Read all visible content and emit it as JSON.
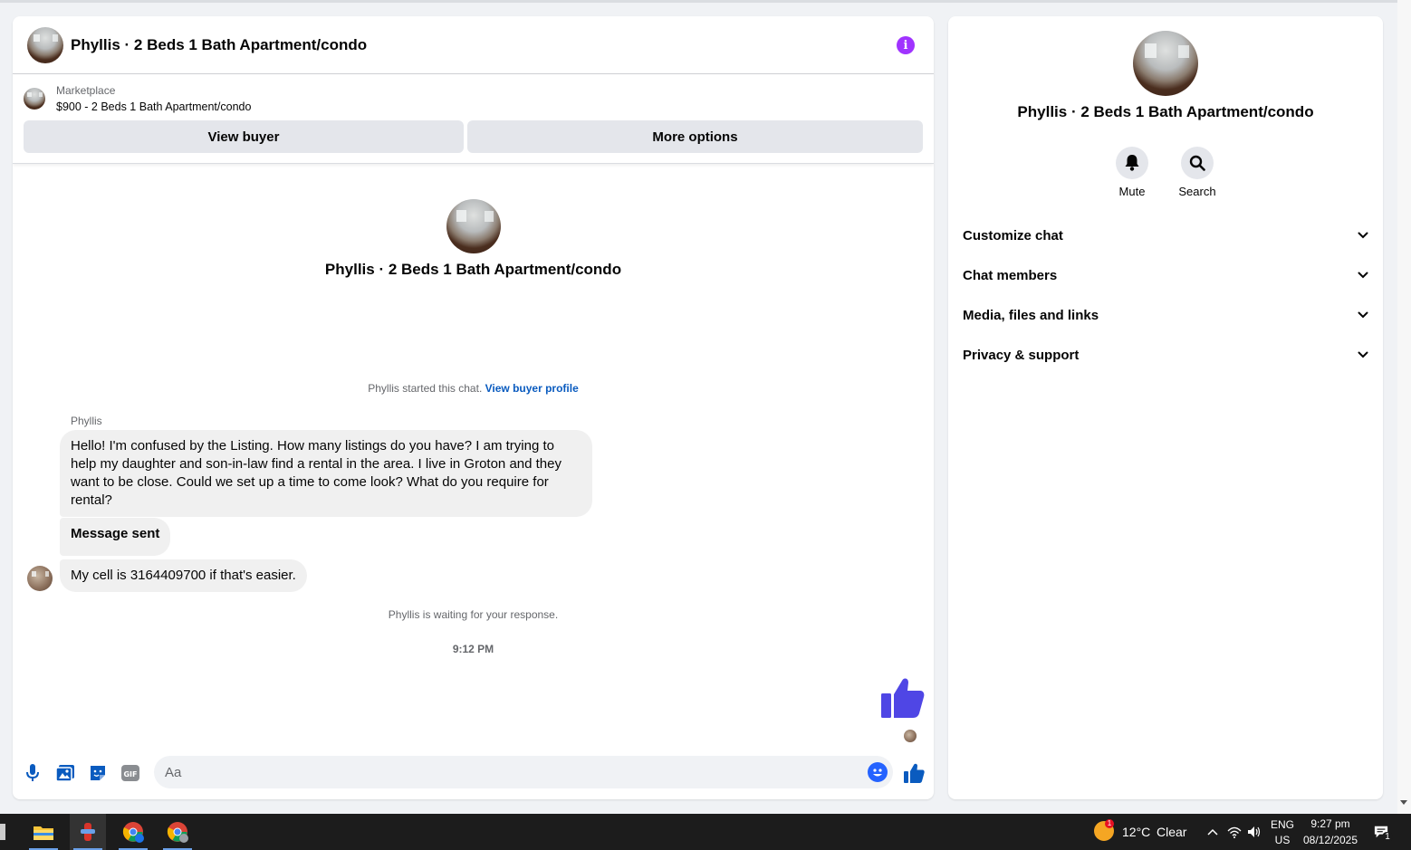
{
  "header": {
    "title": "Phyllis · 2 Beds 1 Bath Apartment/condo"
  },
  "marketplace": {
    "label": "Marketplace",
    "listing": "$900 - 2 Beds 1 Bath Apartment/condo",
    "view_buyer_label": "View buyer",
    "more_options_label": "More options"
  },
  "conversation": {
    "intro_title": "Phyllis · 2 Beds 1 Bath Apartment/condo",
    "started_text": "Phyllis started this chat.",
    "view_buyer_profile": "View buyer profile",
    "sender_name": "Phyllis",
    "messages": [
      "Hello!  I'm confused by the Listing.  How many listings do you have?  I am trying to help my daughter and son-in-law find a rental in the area.  I live in Groton and they want to be close.  Could we set up a time to come look?  What do you require for rental?",
      "Message sent",
      "My cell is 3164409700 if that's easier."
    ],
    "waiting_text": "Phyllis is waiting for your response.",
    "timestamp": "9:12 PM"
  },
  "composer": {
    "placeholder": "Aa",
    "gif_label": "GIF"
  },
  "side_panel": {
    "title": "Phyllis · 2 Beds 1 Bath Apartment/condo",
    "actions": [
      {
        "label": "Mute",
        "icon": "bell-icon"
      },
      {
        "label": "Search",
        "icon": "search-icon"
      }
    ],
    "sections": [
      {
        "label": "Customize chat"
      },
      {
        "label": "Chat members"
      },
      {
        "label": "Media, files and links"
      },
      {
        "label": "Privacy & support"
      }
    ]
  },
  "taskbar": {
    "weather_temp": "12°C",
    "weather_desc": "Clear",
    "weather_badge": "1",
    "lang_top": "ENG",
    "lang_bottom": "US",
    "time": "9:27 pm",
    "date": "08/12/2025",
    "notification_count": "1"
  },
  "colors": {
    "accent": "#0a5bbf",
    "like": "#4f46e5",
    "info": "#a033ff",
    "bubble": "#f0f0f0"
  }
}
